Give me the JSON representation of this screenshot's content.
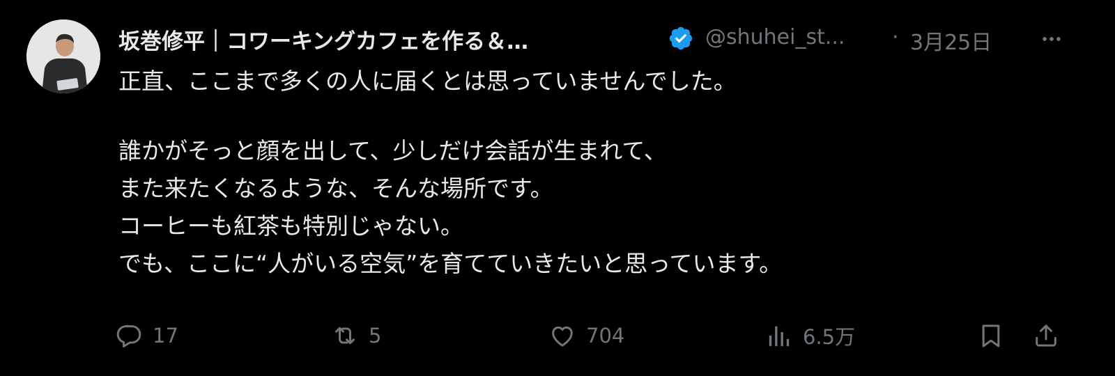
{
  "tweet": {
    "author": {
      "display_name": "坂巻修平｜コワーキングカフェを作る＆…",
      "handle": "@shuhei_st...",
      "verified": true,
      "avatar_icon": "person-photo"
    },
    "separator": "·",
    "date": "3月25日",
    "more_icon": "ellipsis-icon",
    "text_lines": [
      "正直、ここまで多くの人に届くとは思っていませんでした。",
      "",
      "誰かがそっと顔を出して、少しだけ会話が生まれて、",
      "また来たくなるような、そんな場所です。",
      "コーヒーも紅茶も特別じゃない。",
      "でも、ここに“人がいる空気”を育てていきたいと思っています。"
    ],
    "actions": {
      "reply": {
        "icon": "reply-icon",
        "count": "17"
      },
      "retweet": {
        "icon": "retweet-icon",
        "count": "5"
      },
      "like": {
        "icon": "heart-icon",
        "count": "704"
      },
      "views": {
        "icon": "views-icon",
        "count": "6.5万"
      },
      "bookmark": {
        "icon": "bookmark-icon"
      },
      "share": {
        "icon": "share-icon"
      }
    },
    "colors": {
      "background": "#000000",
      "primary_text": "#e7e9ea",
      "secondary_text": "#71767b",
      "verified_blue": "#1d9bf0"
    }
  }
}
